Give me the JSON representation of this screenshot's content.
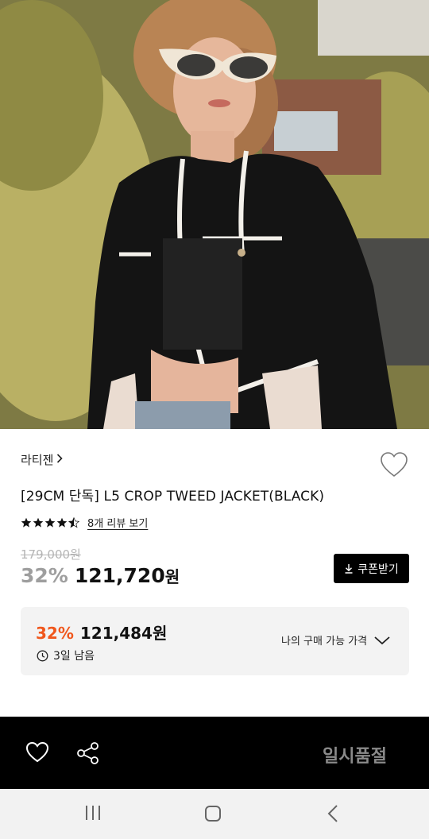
{
  "product": {
    "brand": "라티젠",
    "brand_chevron": "›",
    "title": "[29CM 단독] L5 CROP TWEED JACKET(BLACK)",
    "rating_stars": 4.5,
    "review_link": "8개 리뷰 보기",
    "original_price": "179,000원",
    "discount_rate": "32%",
    "sale_price": "121,720",
    "price_unit": "원"
  },
  "coupon": {
    "label": "쿠폰받기",
    "icon": "download-icon"
  },
  "my_price": {
    "discount_rate": "32%",
    "price": "121,484원",
    "time_left": "3일 남음",
    "label": "나의 구매 가능 가격",
    "accent_color": "#f0571c"
  },
  "action_bar": {
    "status": "일시품절",
    "icons": [
      "heart-icon",
      "share-icon"
    ]
  },
  "system_nav": {
    "icons": [
      "recent-apps-icon",
      "home-icon",
      "back-icon"
    ]
  },
  "hero_image": {
    "alt_description_icon": "product-photo"
  }
}
